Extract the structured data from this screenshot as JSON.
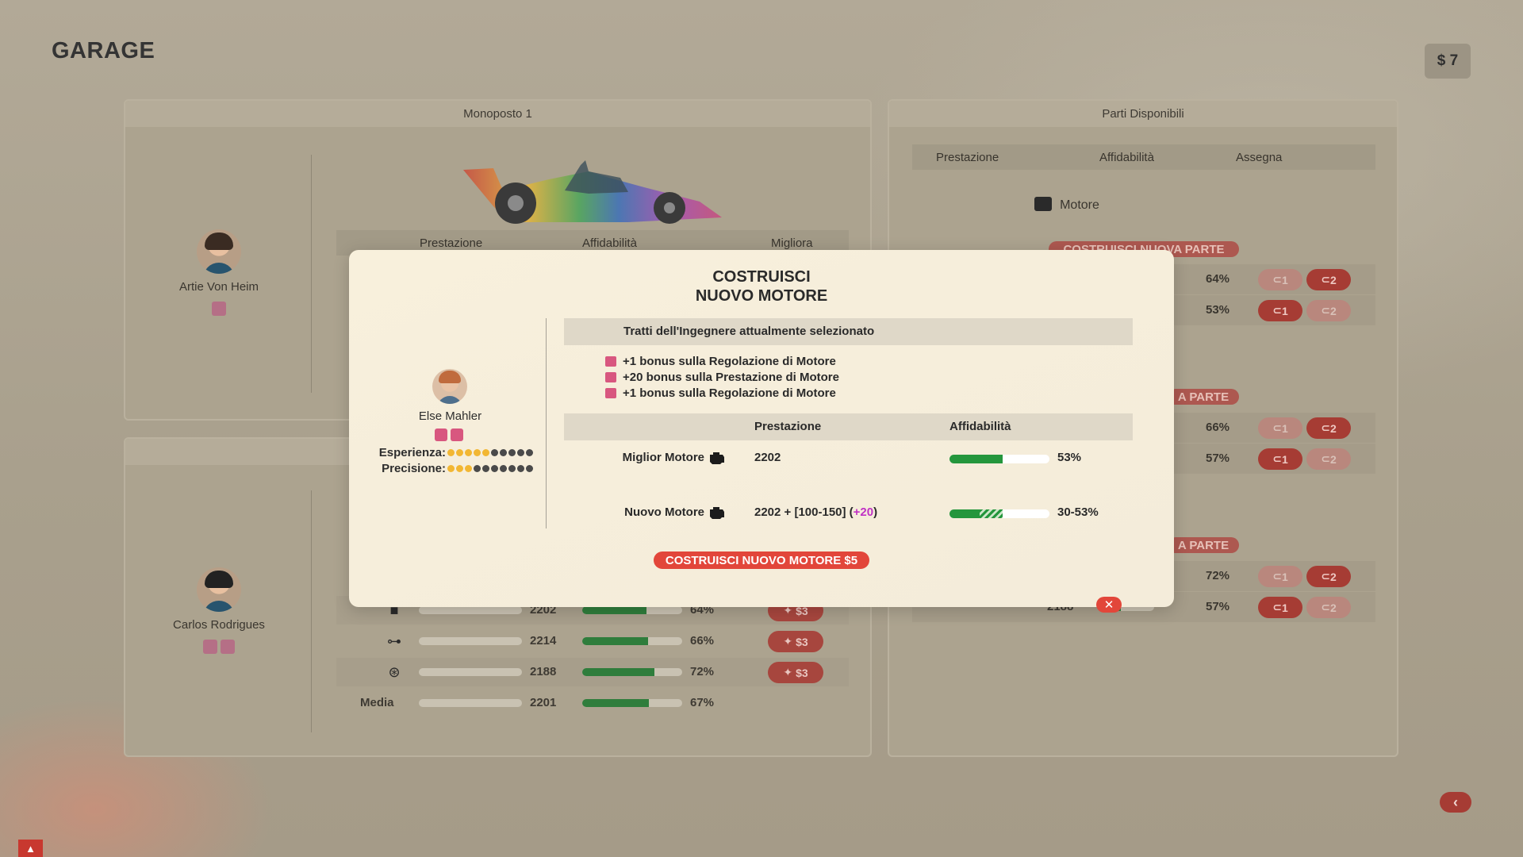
{
  "page": {
    "title": "GARAGE",
    "money": "$ 7"
  },
  "car_panel": {
    "title": "Monoposto 1",
    "driver1": {
      "name": "Artie Von Heim"
    },
    "driver2": {
      "name": "Carlos Rodrigues"
    },
    "table_headers": [
      "Prestazione",
      "Affidabilità",
      "Migliora"
    ],
    "rows": [
      {
        "icon": "engine-icon",
        "value": "2202",
        "reliability_pct": "64%",
        "reliability_level": 0.64,
        "upgrade": "$3"
      },
      {
        "icon": "gearbox-icon",
        "value": "2214",
        "reliability_pct": "66%",
        "reliability_level": 0.66,
        "upgrade": "$3"
      },
      {
        "icon": "brakes-icon",
        "value": "2188",
        "reliability_pct": "72%",
        "reliability_level": 0.72,
        "upgrade": "$3"
      }
    ],
    "average": {
      "label": "Media",
      "value": "2201",
      "reliability_pct": "67%",
      "reliability_level": 0.67
    }
  },
  "parts_panel": {
    "title": "Parti Disponibili",
    "headers": [
      "Prestazione",
      "Affidabilità",
      "Assegna"
    ],
    "category": "Motore",
    "build_label": "COSTRUISCI NUOVA PARTE",
    "build_label_partial": "A PARTE",
    "rows_pct": [
      "64%",
      "53%",
      "66%",
      "57%",
      "72%",
      "57%"
    ],
    "partial_value": "2188",
    "seat1": "1",
    "seat2": "2"
  },
  "modal": {
    "title_line1": "COSTRUISCI",
    "title_line2": "NUOVO MOTORE",
    "engineer": {
      "name": "Else Mahler",
      "experience_label": "Esperienza:",
      "experience_level": 5,
      "precision_label": "Precisione:",
      "precision_level": 3,
      "max_level": 10
    },
    "traits_header": "Tratti dell'Ingegnere attualmente selezionato",
    "traits": [
      "+1 bonus sulla Regolazione di Motore",
      "+20 bonus sulla Prestazione di Motore",
      "+1 bonus sulla Regolazione di Motore"
    ],
    "compare_headers": {
      "performance": "Prestazione",
      "reliability": "Affidabilità"
    },
    "best": {
      "label": "Miglior Motore",
      "value": "2202",
      "reliability": "53%",
      "reliability_level": 0.53
    },
    "new": {
      "label": "Nuovo Motore",
      "value_base": "2202 + [100-150] (",
      "value_bonus": "+20",
      "value_end": ")",
      "reliability": "30-53%",
      "reliability_min": 0.3,
      "reliability_max": 0.53
    },
    "build_button": "COSTRUISCI NUOVO MOTORE $5",
    "close": "✕"
  },
  "colors": {
    "accent_red": "#e2463a",
    "bar_green": "#24963c",
    "bonus_purple": "#c031c4"
  }
}
